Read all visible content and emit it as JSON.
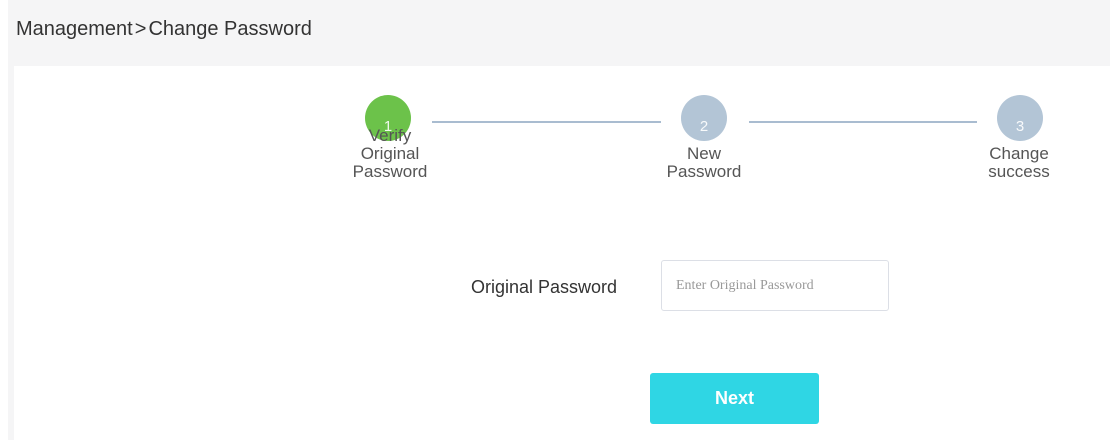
{
  "breadcrumb": {
    "parent": "Management",
    "separator": ">",
    "current": "Change Password"
  },
  "stepper": {
    "steps": [
      {
        "number": "1",
        "label_line1": "Verify",
        "label_line2": "Original",
        "label_line3": "Password",
        "state": "active"
      },
      {
        "number": "2",
        "label_line1": "New",
        "label_line2": "Password",
        "state": "pending"
      },
      {
        "number": "3",
        "label_line1": "Change",
        "label_line2": "success",
        "state": "pending"
      }
    ]
  },
  "form": {
    "original_password": {
      "label": "Original Password",
      "placeholder": "Enter Original Password",
      "value": ""
    },
    "next_label": "Next"
  },
  "colors": {
    "active_step": "#6cc24a",
    "pending_step": "#b3c5d6",
    "step_line": "#a9bcd0",
    "primary_button": "#2fd6e4",
    "page_background": "#f5f5f6"
  }
}
